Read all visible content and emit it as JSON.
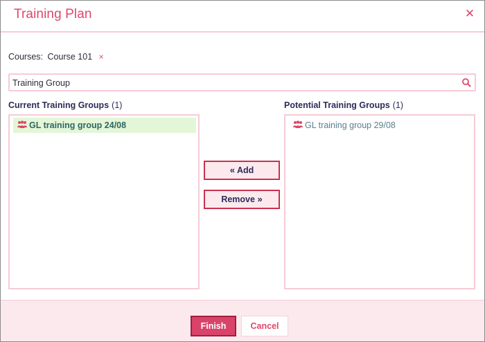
{
  "dialog": {
    "title": "Training Plan",
    "close_icon": "close-icon"
  },
  "courses": {
    "label": "Courses:",
    "value": "Course 101",
    "remove_glyph": "×"
  },
  "search": {
    "value": "Training Group",
    "icon": "search-icon"
  },
  "current_groups": {
    "heading": "Current Training Groups",
    "count": "(1)",
    "items": [
      {
        "label": "GL training group 24/08",
        "selected": true,
        "icon": "group-icon"
      }
    ]
  },
  "potential_groups": {
    "heading": "Potential Training Groups",
    "count": "(1)",
    "items": [
      {
        "label": "GL training group 29/08",
        "selected": false,
        "icon": "group-icon"
      }
    ]
  },
  "transfer": {
    "add_label": "Add",
    "add_glyph": "«",
    "remove_label": "Remove",
    "remove_glyph": "»"
  },
  "footer": {
    "finish_label": "Finish",
    "cancel_label": "Cancel"
  },
  "colors": {
    "accent": "#e0476a",
    "border": "#f6cbd5",
    "selected_bg": "#e3f6d8",
    "finish_bg": "#d9436a"
  }
}
